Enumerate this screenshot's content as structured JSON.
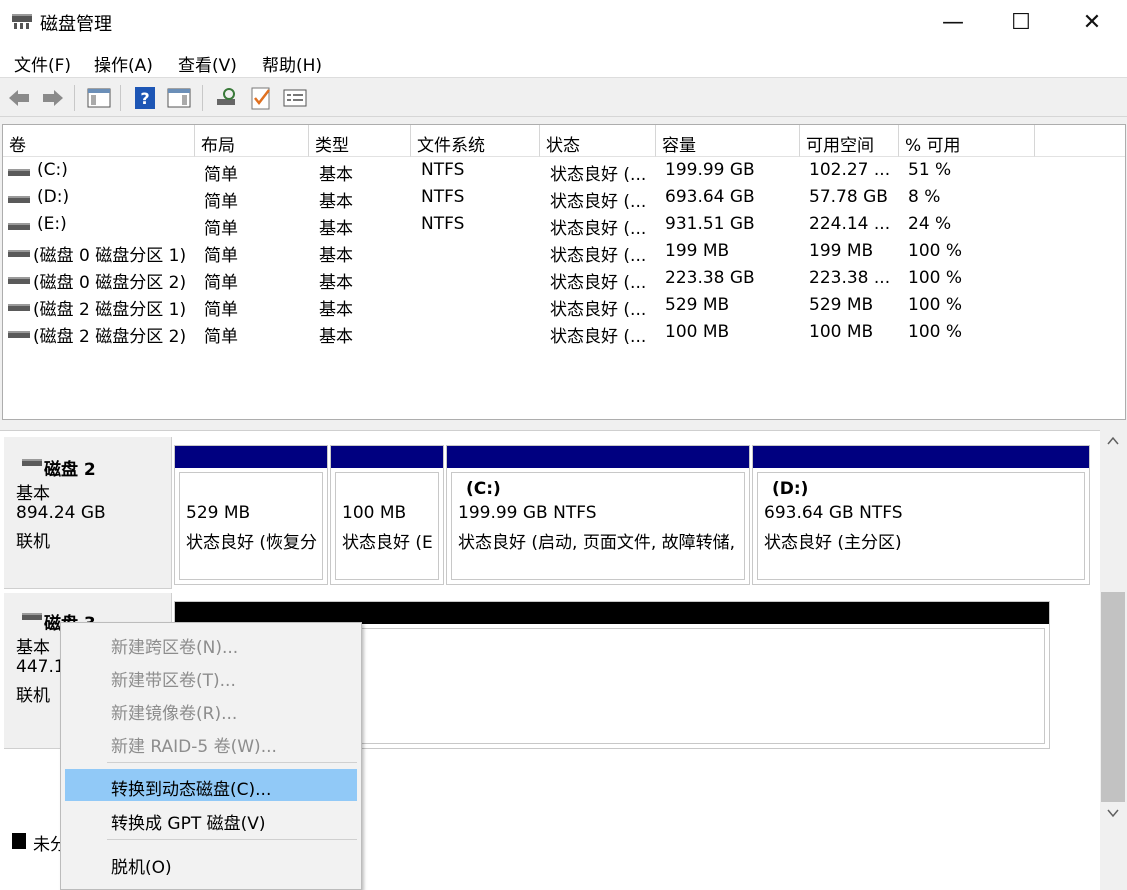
{
  "window": {
    "title": "磁盘管理",
    "minimize": "—",
    "maximize": "☐",
    "close": "✕"
  },
  "menu": [
    "文件(F)",
    "操作(A)",
    "查看(V)",
    "帮助(H)"
  ],
  "toolbar": [
    "back-icon",
    "forward-icon",
    "show-hide-console-icon",
    "help-icon",
    "properties-icon",
    "rescan-icon",
    "check-icon",
    "settings-icon"
  ],
  "columns": [
    "卷",
    "布局",
    "类型",
    "文件系统",
    "状态",
    "容量",
    "可用空间",
    "% 可用"
  ],
  "volumes": [
    {
      "name": "(C:)",
      "layout": "简单",
      "type": "基本",
      "fs": "NTFS",
      "status": "状态良好 (...",
      "capacity": "199.99 GB",
      "free": "102.27 ...",
      "pct": "51 %"
    },
    {
      "name": "(D:)",
      "layout": "简单",
      "type": "基本",
      "fs": "NTFS",
      "status": "状态良好 (...",
      "capacity": "693.64 GB",
      "free": "57.78 GB",
      "pct": "8 %"
    },
    {
      "name": "(E:)",
      "layout": "简单",
      "type": "基本",
      "fs": "NTFS",
      "status": "状态良好 (...",
      "capacity": "931.51 GB",
      "free": "224.14 ...",
      "pct": "24 %"
    },
    {
      "name": "(磁盘 0 磁盘分区 1)",
      "layout": "简单",
      "type": "基本",
      "fs": "",
      "status": "状态良好 (...",
      "capacity": "199 MB",
      "free": "199 MB",
      "pct": "100 %"
    },
    {
      "name": "(磁盘 0 磁盘分区 2)",
      "layout": "简单",
      "type": "基本",
      "fs": "",
      "status": "状态良好 (...",
      "capacity": "223.38 GB",
      "free": "223.38 ...",
      "pct": "100 %"
    },
    {
      "name": "(磁盘 2 磁盘分区 1)",
      "layout": "简单",
      "type": "基本",
      "fs": "",
      "status": "状态良好 (...",
      "capacity": "529 MB",
      "free": "529 MB",
      "pct": "100 %"
    },
    {
      "name": "(磁盘 2 磁盘分区 2)",
      "layout": "简单",
      "type": "基本",
      "fs": "",
      "status": "状态良好 (...",
      "capacity": "100 MB",
      "free": "100 MB",
      "pct": "100 %"
    }
  ],
  "disk2": {
    "name": "磁盘 2",
    "type": "基本",
    "size": "894.24 GB",
    "state": "联机",
    "partitions": [
      {
        "title": "",
        "size": "529 MB",
        "status": "状态良好 (恢复分"
      },
      {
        "title": "",
        "size": "100 MB",
        "status": "状态良好 (E"
      },
      {
        "title": "(C:)",
        "size": "199.99 GB NTFS",
        "status": "状态良好 (启动, 页面文件, 故障转储,"
      },
      {
        "title": "(D:)",
        "size": "693.64 GB NTFS",
        "status": "状态良好 (主分区)"
      }
    ]
  },
  "disk3": {
    "name": "磁盘 3",
    "type": "基本",
    "size": "447.1",
    "state": "联机"
  },
  "legend": "未分",
  "context_menu": [
    {
      "label": "新建跨区卷(N)...",
      "enabled": false
    },
    {
      "label": "新建带区卷(T)...",
      "enabled": false
    },
    {
      "label": "新建镜像卷(R)...",
      "enabled": false
    },
    {
      "label": "新建 RAID-5 卷(W)...",
      "enabled": false
    },
    {
      "label": "转换到动态磁盘(C)...",
      "enabled": true,
      "highlighted": true
    },
    {
      "label": "转换成 GPT 磁盘(V)",
      "enabled": true
    },
    {
      "label": "脱机(O)",
      "enabled": true
    }
  ],
  "colors": {
    "partition_bar": "#000080",
    "unallocated_bar": "#000000",
    "highlight": "#91c9f7"
  }
}
